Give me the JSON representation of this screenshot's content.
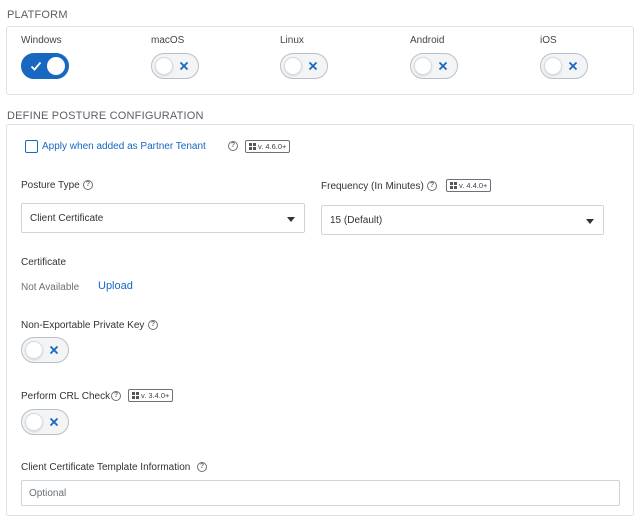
{
  "platform": {
    "title": "PLATFORM",
    "items": [
      {
        "label": "Windows",
        "enabled": true
      },
      {
        "label": "macOS",
        "enabled": false
      },
      {
        "label": "Linux",
        "enabled": false
      },
      {
        "label": "Android",
        "enabled": false
      },
      {
        "label": "iOS",
        "enabled": false
      }
    ]
  },
  "posture": {
    "title": "DEFINE POSTURE CONFIGURATION",
    "partner_tenant": {
      "label": "Apply when added as Partner Tenant",
      "checked": false,
      "version": "v. 4.6.0+"
    },
    "posture_type": {
      "label": "Posture Type",
      "value": "Client Certificate"
    },
    "frequency": {
      "label": "Frequency (In Minutes)",
      "version": "v. 4.4.0+",
      "value": "15 (Default)"
    },
    "certificate": {
      "label": "Certificate",
      "status": "Not Available",
      "upload_label": "Upload"
    },
    "non_exportable": {
      "label": "Non-Exportable Private Key",
      "enabled": false
    },
    "crl_check": {
      "label": "Perform CRL Check",
      "version": "v. 3.4.0+",
      "enabled": false
    },
    "template_info": {
      "label": "Client Certificate Template Information",
      "placeholder": "Optional"
    }
  },
  "colors": {
    "accent": "#1867c0",
    "border": "#dde1e6"
  },
  "icons": {
    "help": "help-circle-icon",
    "windows": "windows-icon",
    "check": "check-icon",
    "cross": "x-icon",
    "caret": "caret-down-icon"
  }
}
